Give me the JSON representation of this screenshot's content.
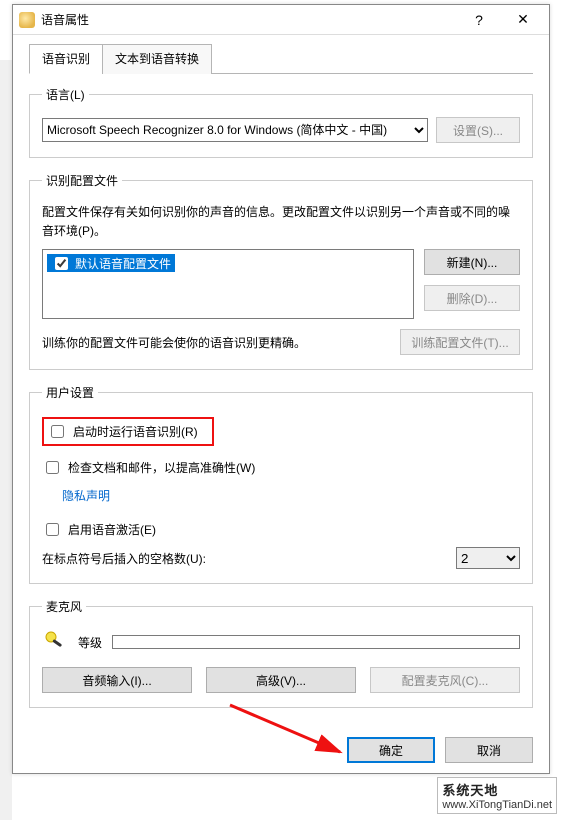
{
  "window": {
    "title": "语音属性"
  },
  "tabs": {
    "recognition": "语音识别",
    "tts": "文本到语音转换"
  },
  "lang_group": {
    "legend": "语言(L)",
    "selected": "Microsoft Speech Recognizer 8.0 for Windows (简体中文 - 中国)",
    "settings_btn": "设置(S)..."
  },
  "profile_group": {
    "legend": "识别配置文件",
    "desc": "配置文件保存有关如何识别你的声音的信息。更改配置文件以识别另一个声音或不同的噪音环境(P)。",
    "item": "默认语音配置文件",
    "new_btn": "新建(N)...",
    "delete_btn": "删除(D)...",
    "train_desc": "训练你的配置文件可能会使你的语音识别更精确。",
    "train_btn": "训练配置文件(T)..."
  },
  "user_group": {
    "legend": "用户设置",
    "run_on_start": "启动时运行语音识别(R)",
    "review_docs": "检查文档和邮件，以提高准确性(W)",
    "privacy": "隐私声明",
    "enable_activation": "启用语音激活(E)",
    "spaces_label": "在标点符号后插入的空格数(U):",
    "spaces_value": "2"
  },
  "mic_group": {
    "legend": "麦克风",
    "level_label": "等级",
    "audio_input_btn": "音频输入(I)...",
    "advanced_btn": "高级(V)...",
    "config_mic_btn": "配置麦克风(C)..."
  },
  "footer": {
    "ok": "确定",
    "cancel": "取消"
  },
  "watermark": {
    "line1": "系统天地",
    "line2": "www.XiTongTianDi.net"
  }
}
